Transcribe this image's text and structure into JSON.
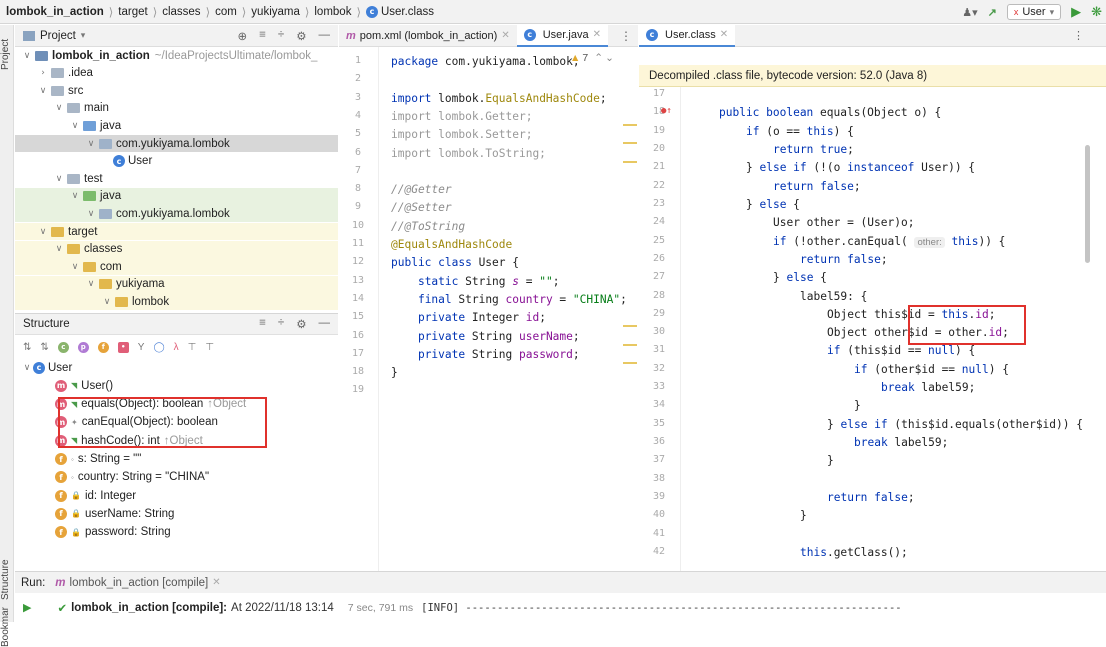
{
  "breadcrumb": {
    "items": [
      "lombok_in_action",
      "target",
      "classes",
      "com",
      "yukiyama",
      "lombok",
      "User.class"
    ]
  },
  "toolbar": {
    "run_config": "User",
    "config_icon_letter": "x"
  },
  "left_strip": {
    "project": "Project",
    "structure": "Structure",
    "bookmarks": "Bookmarks"
  },
  "project_panel": {
    "title": "Project",
    "tree": [
      {
        "label": "lombok_in_action",
        "extra": "~/IdeaProjectsUltimate/lombok_",
        "indent": 0,
        "open": true,
        "kind": "module"
      },
      {
        "label": ".idea",
        "indent": 1,
        "open": false,
        "kind": "folder"
      },
      {
        "label": "src",
        "indent": 1,
        "open": true,
        "kind": "folder"
      },
      {
        "label": "main",
        "indent": 2,
        "open": true,
        "kind": "folder"
      },
      {
        "label": "java",
        "indent": 3,
        "open": true,
        "kind": "src"
      },
      {
        "label": "com.yukiyama.lombok",
        "indent": 4,
        "open": true,
        "kind": "pkg",
        "selected": true
      },
      {
        "label": "User",
        "indent": 5,
        "kind": "class"
      },
      {
        "label": "test",
        "indent": 2,
        "open": true,
        "kind": "folder"
      },
      {
        "label": "java",
        "indent": 3,
        "open": true,
        "kind": "test"
      },
      {
        "label": "com.yukiyama.lombok",
        "indent": 4,
        "open": true,
        "kind": "pkg-test"
      },
      {
        "label": "target",
        "indent": 1,
        "open": true,
        "kind": "excluded"
      },
      {
        "label": "classes",
        "indent": 2,
        "open": true,
        "kind": "excluded"
      },
      {
        "label": "com",
        "indent": 3,
        "open": true,
        "kind": "excluded"
      },
      {
        "label": "yukiyama",
        "indent": 4,
        "open": true,
        "kind": "excluded"
      },
      {
        "label": "lombok",
        "indent": 5,
        "open": true,
        "kind": "excluded"
      }
    ]
  },
  "structure_panel": {
    "title": "Structure",
    "root": "User",
    "members": [
      {
        "icon": "m",
        "text": "User()",
        "suffix": "",
        "vis": "public"
      },
      {
        "icon": "m",
        "text": "equals(Object): boolean",
        "suffix": "↑Object",
        "vis": "public"
      },
      {
        "icon": "m",
        "text": "canEqual(Object): boolean",
        "suffix": "",
        "vis": "protected"
      },
      {
        "icon": "m",
        "text": "hashCode(): int",
        "suffix": "↑Object",
        "vis": "public"
      },
      {
        "icon": "f",
        "text": "s: String = \"\"",
        "suffix": "",
        "vis": "package"
      },
      {
        "icon": "f",
        "text": "country: String = \"CHINA\"",
        "suffix": "",
        "vis": "package"
      },
      {
        "icon": "f",
        "text": "id: Integer",
        "suffix": "",
        "vis": "private"
      },
      {
        "icon": "f",
        "text": "userName: String",
        "suffix": "",
        "vis": "private"
      },
      {
        "icon": "f",
        "text": "password: String",
        "suffix": "",
        "vis": "private"
      }
    ]
  },
  "editor_left": {
    "tabs": [
      {
        "label": "pom.xml (lombok_in_action)",
        "icon": "m",
        "active": false
      },
      {
        "label": "User.java",
        "icon": "c",
        "active": true
      }
    ],
    "warning_count": "7",
    "lines": [
      {
        "n": "1",
        "html": "<span class='kw'>package</span> com.yukiyama.lombok;"
      },
      {
        "n": "2",
        "html": ""
      },
      {
        "n": "3",
        "html": "<span class='kw'>import</span> lombok.<span class='an'>EqualsAndHashCode</span>;"
      },
      {
        "n": "4",
        "html": "<span class='gray'>import lombok.Getter;</span>"
      },
      {
        "n": "5",
        "html": "<span class='gray'>import lombok.Setter;</span>"
      },
      {
        "n": "6",
        "html": "<span class='gray'>import lombok.ToString;</span>"
      },
      {
        "n": "7",
        "html": ""
      },
      {
        "n": "8",
        "html": "<span class='cm'>//@Getter</span>"
      },
      {
        "n": "9",
        "html": "<span class='cm'>//@Setter</span>"
      },
      {
        "n": "10",
        "html": "<span class='cm'>//@ToString</span>"
      },
      {
        "n": "11",
        "html": "<span class='an'>@EqualsAndHashCode</span>"
      },
      {
        "n": "12",
        "html": "<span class='kw'>public class</span> User {"
      },
      {
        "n": "13",
        "html": "    <span class='kw'>static</span> String <span class='fd it'>s</span> = <span class='st'>\"\"</span>;"
      },
      {
        "n": "14",
        "html": "    <span class='kw'>final</span> String <span class='fd'>country</span> = <span class='st'>\"CHINA\"</span>;"
      },
      {
        "n": "15",
        "html": "    <span class='kw'>private</span> Integer <span class='fd'>id</span>;"
      },
      {
        "n": "16",
        "html": "    <span class='kw'>private</span> String <span class='fd'>userName</span>;"
      },
      {
        "n": "17",
        "html": "    <span class='kw'>private</span> String <span class='fd'>password</span>;"
      },
      {
        "n": "18",
        "html": "}"
      },
      {
        "n": "19",
        "html": ""
      }
    ]
  },
  "editor_right": {
    "tab": "User.class",
    "banner": "Decompiled .class file, bytecode version: 52.0 (Java 8)",
    "lines": [
      {
        "n": "17",
        "ind": 0,
        "html": ""
      },
      {
        "n": "18",
        "ind": 0,
        "html": "<span class='kw'>public boolean</span> equals(Object o) {"
      },
      {
        "n": "19",
        "ind": 1,
        "html": "<span class='kw'>if</span> (o == <span class='kw'>this</span>) {"
      },
      {
        "n": "20",
        "ind": 2,
        "html": "<span class='kw'>return true</span>;"
      },
      {
        "n": "21",
        "ind": 1,
        "html": "} <span class='kw'>else if</span> (!(o <span class='kw'>instanceof</span> User)) {"
      },
      {
        "n": "22",
        "ind": 2,
        "html": "<span class='kw'>return false</span>;"
      },
      {
        "n": "23",
        "ind": 1,
        "html": "} <span class='kw'>else</span> {"
      },
      {
        "n": "24",
        "ind": 2,
        "html": "User other = (User)o;"
      },
      {
        "n": "25",
        "ind": 2,
        "html": "<span class='kw'>if</span> (!other.canEqual( <span class='hint'>other:</span> <span class='kw'>this</span>)) {"
      },
      {
        "n": "26",
        "ind": 3,
        "html": "<span class='kw'>return false</span>;"
      },
      {
        "n": "27",
        "ind": 2,
        "html": "} <span class='kw'>else</span> {"
      },
      {
        "n": "28",
        "ind": 3,
        "html": "label59: {"
      },
      {
        "n": "29",
        "ind": 4,
        "html": "Object this$id = <span class='kw'>this</span>.<span class='fd'>id</span>;"
      },
      {
        "n": "30",
        "ind": 4,
        "html": "Object other$id = other.<span class='fd'>id</span>;"
      },
      {
        "n": "31",
        "ind": 4,
        "html": "<span class='kw'>if</span> (this$id == <span class='kw'>null</span>) {"
      },
      {
        "n": "32",
        "ind": 5,
        "html": "<span class='kw'>if</span> (other$id == <span class='kw'>null</span>) {"
      },
      {
        "n": "33",
        "ind": 6,
        "html": "<span class='kw'>break</span> label59;"
      },
      {
        "n": "34",
        "ind": 5,
        "html": "}"
      },
      {
        "n": "35",
        "ind": 4,
        "html": "} <span class='kw'>else if</span> (this$id.equals(other$id)) {"
      },
      {
        "n": "36",
        "ind": 5,
        "html": "<span class='kw'>break</span> label59;"
      },
      {
        "n": "37",
        "ind": 4,
        "html": "}"
      },
      {
        "n": "38",
        "ind": 0,
        "html": ""
      },
      {
        "n": "39",
        "ind": 4,
        "html": "<span class='kw'>return false</span>;"
      },
      {
        "n": "40",
        "ind": 3,
        "html": "}"
      },
      {
        "n": "41",
        "ind": 0,
        "html": ""
      },
      {
        "n": "42",
        "ind": 3,
        "html": "<span class='kw'>this</span>.getClass();"
      }
    ]
  },
  "run_panel": {
    "label": "Run:",
    "tab": "lombok_in_action [compile]",
    "entry_title": "lombok_in_action [compile]:",
    "entry_time": "At 2022/11/18 13:14",
    "duration": "7 sec, 791 ms",
    "log": "[INFO] ---------------------------------------------------------------------"
  },
  "colors": {
    "accent": "#4a88d6",
    "highlight_box": "#e0312c",
    "keyword": "#0033b3",
    "field": "#871094"
  }
}
